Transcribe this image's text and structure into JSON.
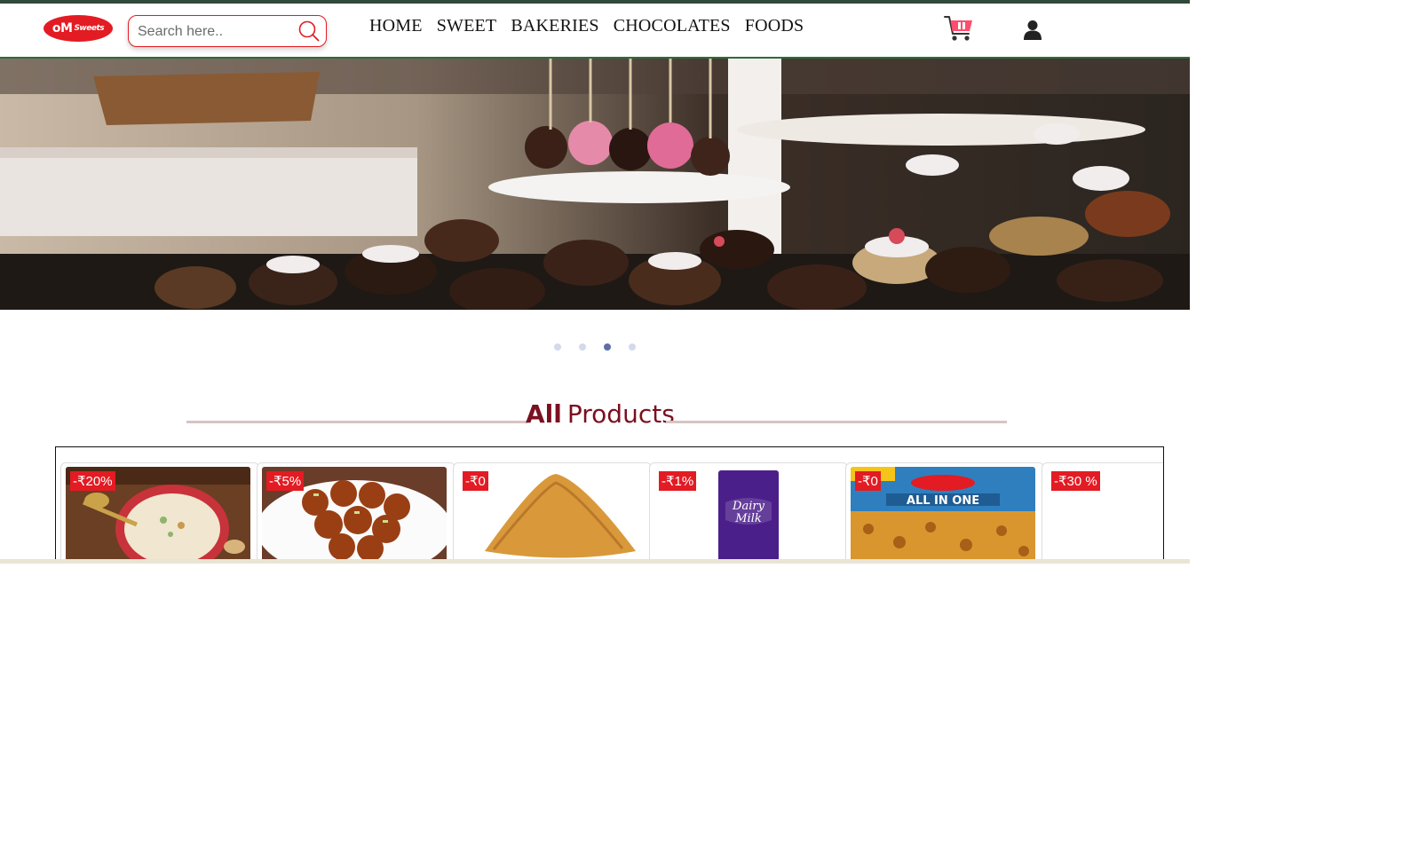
{
  "header": {
    "logo_text": "oM",
    "logo_subtext": "Sweets",
    "search_placeholder": "Search here..",
    "nav": [
      "HOME",
      "SWEET",
      "BAKERIES",
      "CHOCOLATES",
      "FOODS"
    ]
  },
  "carousel": {
    "slide_count": 4,
    "active_index": 2
  },
  "section": {
    "title_bold": "All",
    "title_rest": "Products"
  },
  "products": [
    {
      "badge": "-₹20%",
      "icon": "kheer-bowl-image"
    },
    {
      "badge": "-₹5%",
      "icon": "gulab-jamun-image"
    },
    {
      "badge": "-₹0",
      "icon": "samosa-image"
    },
    {
      "badge": "-₹1%",
      "icon": "dairy-milk-image"
    },
    {
      "badge": "-₹0",
      "icon": "haldiram-namkeen-image"
    },
    {
      "badge": "-₹30 %",
      "icon": "product-image"
    }
  ],
  "colors": {
    "brand_red": "#e31b23",
    "title_maroon": "#7a1020",
    "header_green": "#2e6b3e"
  }
}
